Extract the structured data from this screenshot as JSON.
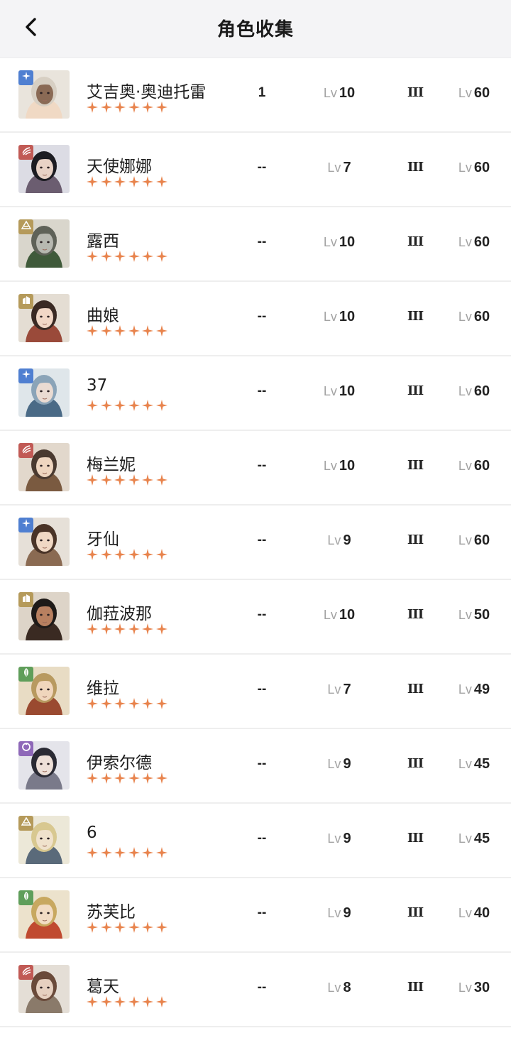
{
  "header": {
    "title": "角色收集",
    "back_icon": "chevron-left-icon"
  },
  "colors": {
    "star": "#e8834c",
    "element_blue": "#4f7fd1",
    "element_red": "#c15a55",
    "element_gold": "#b59a5a",
    "element_green": "#5f9e5a",
    "element_purple": "#8e68b8"
  },
  "characters": [
    {
      "name": "艾吉奥·奥迪托雷",
      "element": "blue",
      "element_icon": "sparkle-icon",
      "stars": 6,
      "rank": "1",
      "lv_prefix": "Lv",
      "level": "10",
      "tier": "III",
      "level2": "60"
    },
    {
      "name": "天使娜娜",
      "element": "red",
      "element_icon": "wave-icon",
      "stars": 6,
      "rank": "--",
      "lv_prefix": "Lv",
      "level": "7",
      "tier": "III",
      "level2": "60"
    },
    {
      "name": "露西",
      "element": "gold",
      "element_icon": "mountain-icon",
      "stars": 6,
      "rank": "--",
      "lv_prefix": "Lv",
      "level": "10",
      "tier": "III",
      "level2": "60"
    },
    {
      "name": "曲娘",
      "element": "gold",
      "element_icon": "building-icon",
      "stars": 6,
      "rank": "--",
      "lv_prefix": "Lv",
      "level": "10",
      "tier": "III",
      "level2": "60"
    },
    {
      "name": "37",
      "element": "blue",
      "element_icon": "sparkle-icon",
      "stars": 6,
      "rank": "--",
      "lv_prefix": "Lv",
      "level": "10",
      "tier": "III",
      "level2": "60"
    },
    {
      "name": "梅兰妮",
      "element": "red",
      "element_icon": "wave-icon",
      "stars": 6,
      "rank": "--",
      "lv_prefix": "Lv",
      "level": "10",
      "tier": "III",
      "level2": "60"
    },
    {
      "name": "牙仙",
      "element": "blue",
      "element_icon": "sparkle-icon",
      "stars": 6,
      "rank": "--",
      "lv_prefix": "Lv",
      "level": "9",
      "tier": "III",
      "level2": "60"
    },
    {
      "name": "伽菈波那",
      "element": "gold",
      "element_icon": "building-icon",
      "stars": 6,
      "rank": "--",
      "lv_prefix": "Lv",
      "level": "10",
      "tier": "III",
      "level2": "50"
    },
    {
      "name": "维拉",
      "element": "green",
      "element_icon": "leaf-icon",
      "stars": 6,
      "rank": "--",
      "lv_prefix": "Lv",
      "level": "7",
      "tier": "III",
      "level2": "49"
    },
    {
      "name": "伊索尔德",
      "element": "purple",
      "element_icon": "moon-icon",
      "stars": 6,
      "rank": "--",
      "lv_prefix": "Lv",
      "level": "9",
      "tier": "III",
      "level2": "45"
    },
    {
      "name": "6",
      "element": "gold",
      "element_icon": "mountain-icon",
      "stars": 6,
      "rank": "--",
      "lv_prefix": "Lv",
      "level": "9",
      "tier": "III",
      "level2": "45"
    },
    {
      "name": "苏芙比",
      "element": "green",
      "element_icon": "leaf-icon",
      "stars": 6,
      "rank": "--",
      "lv_prefix": "Lv",
      "level": "9",
      "tier": "III",
      "level2": "40"
    },
    {
      "name": "葛天",
      "element": "red",
      "element_icon": "wave-icon",
      "stars": 6,
      "rank": "--",
      "lv_prefix": "Lv",
      "level": "8",
      "tier": "III",
      "level2": "30"
    }
  ]
}
